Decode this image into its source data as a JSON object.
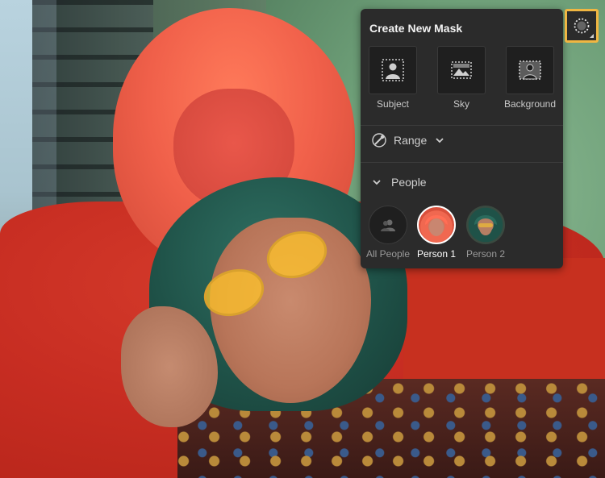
{
  "panel": {
    "title": "Create New Mask",
    "mask_types": [
      {
        "label": "Subject",
        "icon": "subject-icon"
      },
      {
        "label": "Sky",
        "icon": "sky-icon"
      },
      {
        "label": "Background",
        "icon": "background-icon"
      }
    ],
    "range": {
      "label": "Range",
      "icon": "range-brush-icon",
      "state": "collapsed"
    },
    "people": {
      "label": "People",
      "state": "expanded",
      "items": [
        {
          "label": "All People",
          "selected": false
        },
        {
          "label": "Person 1",
          "selected": true
        },
        {
          "label": "Person 2",
          "selected": false
        }
      ]
    }
  },
  "colors": {
    "accent": "#f0b642",
    "panel_bg": "#2b2b2b",
    "mask_overlay": "#cc2a1e"
  },
  "toolbar": {
    "mask_toggle_icon": "mask-circle-icon",
    "mask_toggle_active": true
  }
}
